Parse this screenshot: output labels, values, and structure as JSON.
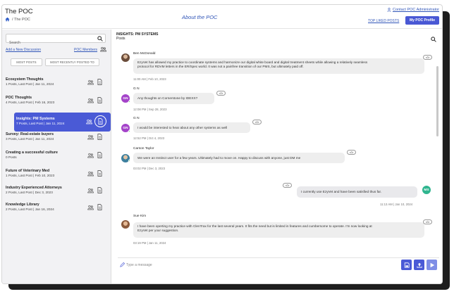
{
  "header": {
    "app_title": "The POC",
    "breadcrumb": "/ The POC",
    "center_title": "About the POC",
    "contact_link": "Contact POC Administrator",
    "top_liked_link": "TOP LIKED POSTS",
    "my_profile_button": "My POC Profile"
  },
  "sidebar": {
    "search_placeholder": "Search",
    "add_discussion": "Add a New Discussion",
    "poc_members": "POC Members",
    "sort_most_posts": "MOST POSTS",
    "sort_recent": "MOST RECENTLY POSTED TO",
    "topics": [
      {
        "title": "Ecosystem Thoughts",
        "sub": "1 Posts, Last Post | Jan 11, 2024"
      },
      {
        "title": "POC Thoughts",
        "sub": "4 Posts, Last Post | Feb 16, 2023"
      },
      {
        "title": "Insights: PM Systems",
        "sub": "7 Posts, Last Post | Jan 11, 2024"
      },
      {
        "title": "Survey: Real-estate buyers",
        "sub": "3 Posts, Last Post | Jan 11, 2024"
      },
      {
        "title": "Creating a successful culture",
        "sub": "0 Posts"
      },
      {
        "title": "Future of Veterinary Med",
        "sub": "1 Posts, Last Post | Feb 10, 2023"
      },
      {
        "title": "Industry Experienced Attorneys",
        "sub": "2 Posts, Last Post | Dec 3, 2023"
      },
      {
        "title": "Knowledge Library",
        "sub": "2 Posts, Last Post | Jan 16, 2024"
      }
    ]
  },
  "thread": {
    "title": "INSIGHTS: PM SYSTEMS",
    "subtitle": "Posts",
    "messages": [
      {
        "author": "Ben McDonald",
        "line1": "EzyVet has allowed my practice to coordinate systems and harmonize our digital white board and digital treatment sheets while allowing a relatively seamless",
        "line2": "protocol for RDVM letters in the ER/Spec world.  It was not a painfree transition of our PMS, but ultimately paid off.",
        "time": "11:00 AM | Feb 10, 2023"
      },
      {
        "author": "G N",
        "avatar": "GN",
        "text": "Any thoughts on Cornerstone by IDEXX?",
        "time": "12:08 PM | Sep 28, 2023"
      },
      {
        "author": "G N",
        "avatar": "GN",
        "text": "I would be interested to hear about any other systems as well",
        "time": "12:52 PM | Oct 4, 2023"
      },
      {
        "author": "Carson Taylor",
        "text": "We were an Instinct user for a few years.  Ultimately had to move on.  Happy to discuss with anyone, just DM me",
        "time": "03:02 PM | Dec 3, 2023"
      },
      {
        "author": "",
        "avatar": "MS",
        "text": "I currently use EzyVet and have been satisfied thus far.",
        "time": "11:13 AM | Jan 10, 2024"
      },
      {
        "author": "Sue Kim",
        "line1": "I have been operting my practice with ClenTrax for the last several years. It fits the need but is limited in features and cumbersome to operate. I'm now looking at",
        "line2": "EzyVet per your suggestion.",
        "time": "03:19 PM | Jan 11, 2024"
      }
    ],
    "composer_placeholder": "Type a message"
  },
  "colors": {
    "accent": "#4a5ad6",
    "link": "#3156b8",
    "gn_avatar": "#a443c9",
    "ms_avatar": "#2fb58f"
  },
  "icons": [
    "home-icon",
    "person-icon",
    "search-icon",
    "members-icon",
    "group-icon",
    "document-icon",
    "thumbs-up-icon",
    "pen-icon",
    "save-icon",
    "upload-icon",
    "send-icon"
  ]
}
